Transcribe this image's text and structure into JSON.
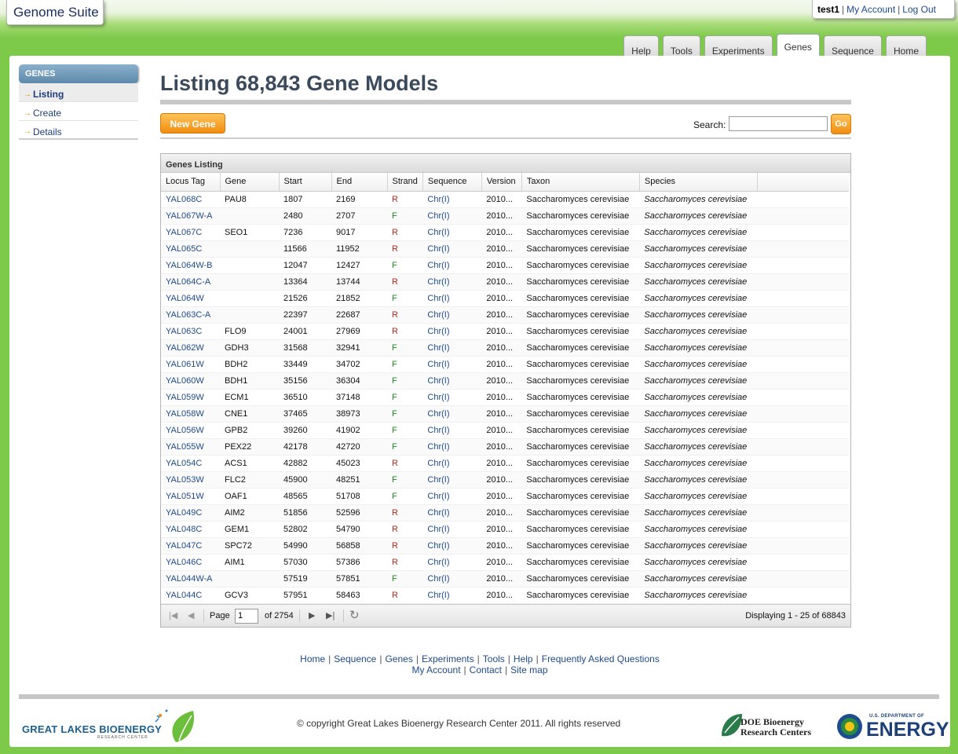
{
  "app": {
    "title": "Genome Suite"
  },
  "user": {
    "name": "test1",
    "my_account": "My Account",
    "logout": "Log Out"
  },
  "tabs": [
    "Help",
    "Tools",
    "Experiments",
    "Genes",
    "Sequence",
    "Home"
  ],
  "active_tab": "Genes",
  "sidebar": {
    "heading": "GENES",
    "items": [
      {
        "label": "Listing",
        "active": true
      },
      {
        "label": "Create",
        "active": false
      },
      {
        "label": "Details",
        "active": false
      }
    ]
  },
  "page": {
    "title": "Listing 68,843 Gene Models"
  },
  "toolbar": {
    "new_label": "New Gene",
    "search_label": "Search:",
    "search_value": "",
    "go_label": "Go"
  },
  "grid": {
    "title": "Genes Listing",
    "columns": [
      "Locus Tag",
      "Gene",
      "Start",
      "End",
      "Strand",
      "Sequence",
      "Version",
      "Taxon",
      "Species"
    ],
    "rows": [
      [
        "YAL068C",
        "PAU8",
        "1807",
        "2169",
        "R",
        "Chr(I)",
        "2010...",
        "Saccharomyces cerevisiae",
        "Saccharomyces cerevisiae"
      ],
      [
        "YAL067W-A",
        "",
        "2480",
        "2707",
        "F",
        "Chr(I)",
        "2010...",
        "Saccharomyces cerevisiae",
        "Saccharomyces cerevisiae"
      ],
      [
        "YAL067C",
        "SEO1",
        "7236",
        "9017",
        "R",
        "Chr(I)",
        "2010...",
        "Saccharomyces cerevisiae",
        "Saccharomyces cerevisiae"
      ],
      [
        "YAL065C",
        "",
        "11566",
        "11952",
        "R",
        "Chr(I)",
        "2010...",
        "Saccharomyces cerevisiae",
        "Saccharomyces cerevisiae"
      ],
      [
        "YAL064W-B",
        "",
        "12047",
        "12427",
        "F",
        "Chr(I)",
        "2010...",
        "Saccharomyces cerevisiae",
        "Saccharomyces cerevisiae"
      ],
      [
        "YAL064C-A",
        "",
        "13364",
        "13744",
        "R",
        "Chr(I)",
        "2010...",
        "Saccharomyces cerevisiae",
        "Saccharomyces cerevisiae"
      ],
      [
        "YAL064W",
        "",
        "21526",
        "21852",
        "F",
        "Chr(I)",
        "2010...",
        "Saccharomyces cerevisiae",
        "Saccharomyces cerevisiae"
      ],
      [
        "YAL063C-A",
        "",
        "22397",
        "22687",
        "R",
        "Chr(I)",
        "2010...",
        "Saccharomyces cerevisiae",
        "Saccharomyces cerevisiae"
      ],
      [
        "YAL063C",
        "FLO9",
        "24001",
        "27969",
        "R",
        "Chr(I)",
        "2010...",
        "Saccharomyces cerevisiae",
        "Saccharomyces cerevisiae"
      ],
      [
        "YAL062W",
        "GDH3",
        "31568",
        "32941",
        "F",
        "Chr(I)",
        "2010...",
        "Saccharomyces cerevisiae",
        "Saccharomyces cerevisiae"
      ],
      [
        "YAL061W",
        "BDH2",
        "33449",
        "34702",
        "F",
        "Chr(I)",
        "2010...",
        "Saccharomyces cerevisiae",
        "Saccharomyces cerevisiae"
      ],
      [
        "YAL060W",
        "BDH1",
        "35156",
        "36304",
        "F",
        "Chr(I)",
        "2010...",
        "Saccharomyces cerevisiae",
        "Saccharomyces cerevisiae"
      ],
      [
        "YAL059W",
        "ECM1",
        "36510",
        "37148",
        "F",
        "Chr(I)",
        "2010...",
        "Saccharomyces cerevisiae",
        "Saccharomyces cerevisiae"
      ],
      [
        "YAL058W",
        "CNE1",
        "37465",
        "38973",
        "F",
        "Chr(I)",
        "2010...",
        "Saccharomyces cerevisiae",
        "Saccharomyces cerevisiae"
      ],
      [
        "YAL056W",
        "GPB2",
        "39260",
        "41902",
        "F",
        "Chr(I)",
        "2010...",
        "Saccharomyces cerevisiae",
        "Saccharomyces cerevisiae"
      ],
      [
        "YAL055W",
        "PEX22",
        "42178",
        "42720",
        "F",
        "Chr(I)",
        "2010...",
        "Saccharomyces cerevisiae",
        "Saccharomyces cerevisiae"
      ],
      [
        "YAL054C",
        "ACS1",
        "42882",
        "45023",
        "R",
        "Chr(I)",
        "2010...",
        "Saccharomyces cerevisiae",
        "Saccharomyces cerevisiae"
      ],
      [
        "YAL053W",
        "FLC2",
        "45900",
        "48251",
        "F",
        "Chr(I)",
        "2010...",
        "Saccharomyces cerevisiae",
        "Saccharomyces cerevisiae"
      ],
      [
        "YAL051W",
        "OAF1",
        "48565",
        "51708",
        "F",
        "Chr(I)",
        "2010...",
        "Saccharomyces cerevisiae",
        "Saccharomyces cerevisiae"
      ],
      [
        "YAL049C",
        "AIM2",
        "51856",
        "52596",
        "R",
        "Chr(I)",
        "2010...",
        "Saccharomyces cerevisiae",
        "Saccharomyces cerevisiae"
      ],
      [
        "YAL048C",
        "GEM1",
        "52802",
        "54790",
        "R",
        "Chr(I)",
        "2010...",
        "Saccharomyces cerevisiae",
        "Saccharomyces cerevisiae"
      ],
      [
        "YAL047C",
        "SPC72",
        "54990",
        "56858",
        "R",
        "Chr(I)",
        "2010...",
        "Saccharomyces cerevisiae",
        "Saccharomyces cerevisiae"
      ],
      [
        "YAL046C",
        "AIM1",
        "57030",
        "57386",
        "R",
        "Chr(I)",
        "2010...",
        "Saccharomyces cerevisiae",
        "Saccharomyces cerevisiae"
      ],
      [
        "YAL044W-A",
        "",
        "57519",
        "57851",
        "F",
        "Chr(I)",
        "2010...",
        "Saccharomyces cerevisiae",
        "Saccharomyces cerevisiae"
      ],
      [
        "YAL044C",
        "GCV3",
        "57951",
        "58463",
        "R",
        "Chr(I)",
        "2010...",
        "Saccharomyces cerevisiae",
        "Saccharomyces cerevisiae"
      ]
    ]
  },
  "pager": {
    "page_label": "Page",
    "page_value": "1",
    "of_label": "of 2754",
    "displaying": "Displaying 1 - 25 of 68843"
  },
  "footer": {
    "links_row1": [
      "Home",
      "Sequence",
      "Genes",
      "Experiments",
      "Tools",
      "Help",
      "Frequently Asked Questions"
    ],
    "links_row2": [
      "My Account",
      "Contact",
      "Site map"
    ],
    "copyright": "© copyright Great Lakes Bioenergy Research Center 2011. All rights reserved",
    "logos": {
      "glbrc_main": "GREAT LAKES BIOENERGY",
      "glbrc_sub": "RESEARCH CENTER",
      "doe_line1": "DOE Bioenergy",
      "doe_line2": "Research Centers",
      "energy_top": "U.S. DEPARTMENT OF",
      "energy_main": "ENERGY"
    }
  },
  "colors": {
    "green": "#7dc94a",
    "link": "#1e4a8a",
    "orange": "#f08d10",
    "strand_r": "#b22b20",
    "strand_f": "#1d8a1d"
  }
}
